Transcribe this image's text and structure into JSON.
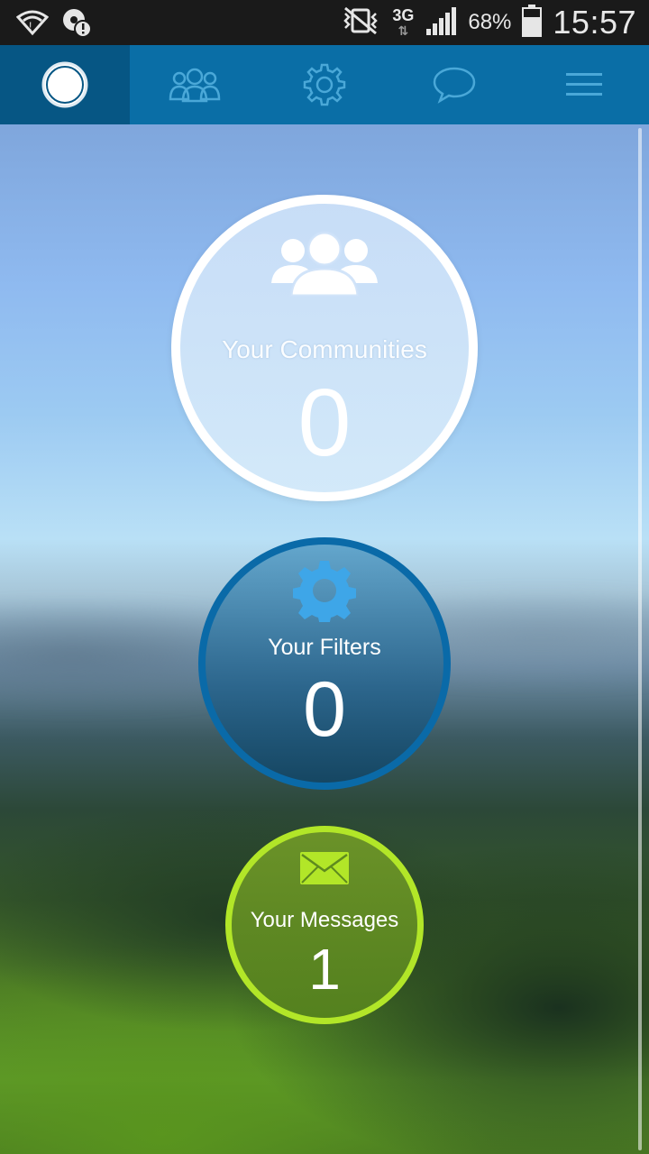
{
  "status_bar": {
    "battery_percent": "68%",
    "time": "15:57",
    "network_type": "3G",
    "icons": [
      "wifi-error-icon",
      "sync-alert-icon",
      "vibrate-mute-icon",
      "network-3g-icon",
      "signal-strength-icon",
      "battery-icon"
    ]
  },
  "nav": {
    "tabs": [
      {
        "icon": "home-circle-icon",
        "active": true
      },
      {
        "icon": "communities-icon",
        "active": false
      },
      {
        "icon": "settings-gear-icon",
        "active": false
      },
      {
        "icon": "chat-bubble-icon",
        "active": false
      },
      {
        "icon": "menu-icon",
        "active": false
      }
    ],
    "colors": {
      "bar": "#0a6ea6",
      "active": "#065684"
    }
  },
  "dashboard": {
    "communities": {
      "label": "Your Communities",
      "count": "0",
      "icon": "people-group-icon"
    },
    "filters": {
      "label": "Your Filters",
      "count": "0",
      "icon": "gear-icon"
    },
    "messages": {
      "label": "Your Messages",
      "count": "1",
      "icon": "envelope-icon"
    }
  },
  "colors": {
    "communities_ring": "#ffffff",
    "filters_ring": "#0a6aa8",
    "messages_ring": "#b2e628"
  }
}
